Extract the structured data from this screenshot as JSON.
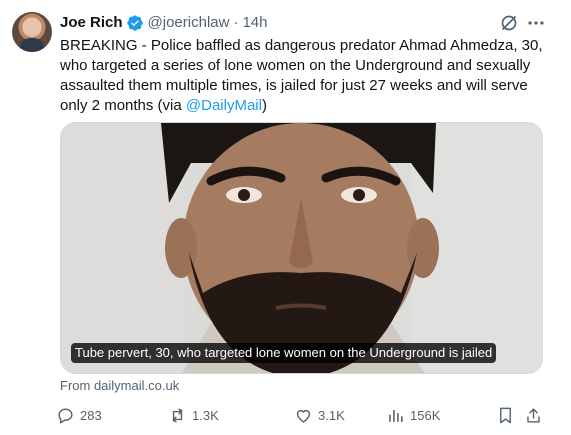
{
  "author": {
    "name": "Joe Rich",
    "handle": "@joerichlaw",
    "separator": "·",
    "time": "14h",
    "verified_icon": "verified-badge-icon"
  },
  "tweet": {
    "text": "BREAKING - Police baffled as dangerous predator Ahmad Ahmedza, 30, who targeted a series of lone women on the Underground and sexually assaulted them multiple times, is jailed for just 27 weeks and will serve only 2 months (via ",
    "mention": "@DailyMail",
    "text_end": ")"
  },
  "card": {
    "caption": "Tube pervert, 30, who targeted lone women on the Underground is jailed",
    "source": "From dailymail.co.uk"
  },
  "actions": {
    "replies": "283",
    "reposts": "1.3K",
    "likes": "3.1K",
    "views": "156K"
  },
  "colors": {
    "text": "#0f1419",
    "secondary": "#536471",
    "accent": "#1d9bf0"
  }
}
